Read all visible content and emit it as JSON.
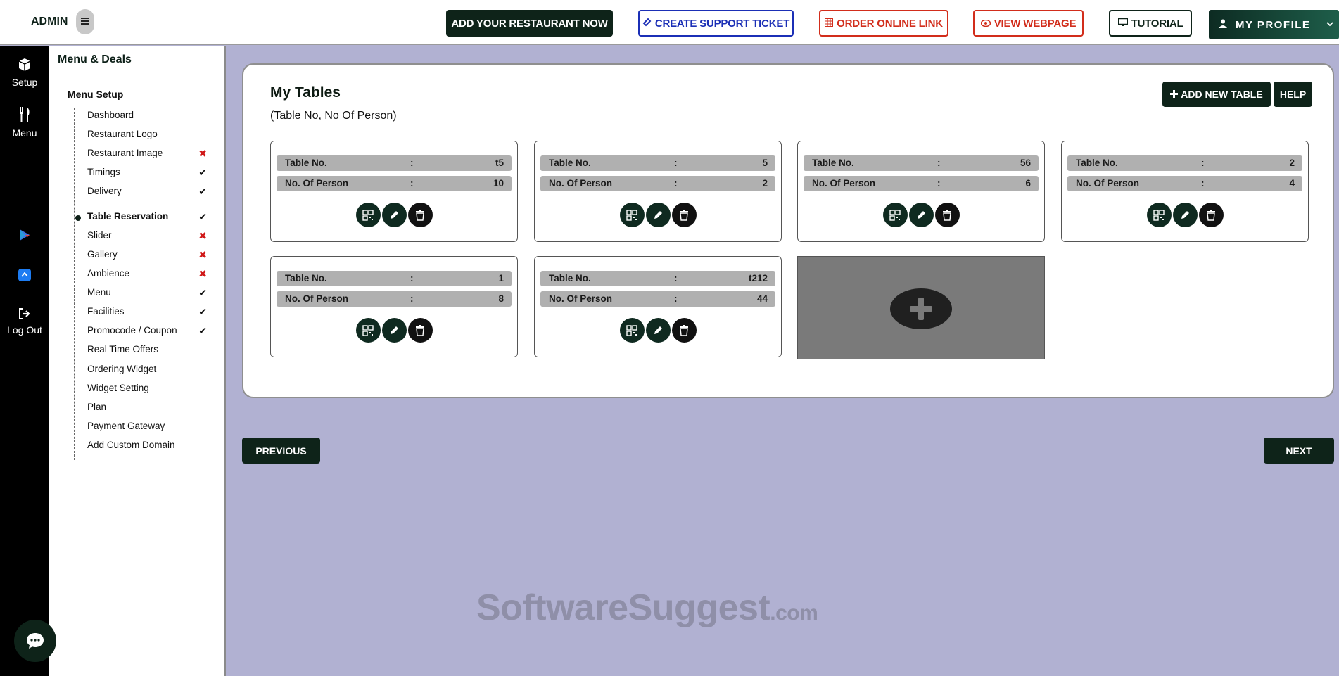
{
  "topbar": {
    "admin_label": "ADMIN",
    "add_restaurant": "ADD YOUR RESTAURANT NOW",
    "support_ticket": "CREATE SUPPORT TICKET",
    "order_online": "ORDER ONLINE LINK",
    "view_webpage": "VIEW WEBPAGE",
    "tutorial": "TUTORIAL",
    "profile": "MY PROFILE"
  },
  "rail": {
    "setup": "Setup",
    "menu": "Menu",
    "logout": "Log Out"
  },
  "sidebar": {
    "title": "Menu & Deals",
    "section": "Menu Setup",
    "items": [
      {
        "label": "Dashboard",
        "status": ""
      },
      {
        "label": "Restaurant Logo",
        "status": ""
      },
      {
        "label": "Restaurant Image",
        "status": "✖"
      },
      {
        "label": "Timings",
        "status": "✔"
      },
      {
        "label": "Delivery",
        "status": "✔"
      },
      {
        "label": "Table Reservation",
        "status": "✔"
      },
      {
        "label": "Slider",
        "status": "✖"
      },
      {
        "label": "Gallery",
        "status": "✖"
      },
      {
        "label": "Ambience",
        "status": "✖"
      },
      {
        "label": "Menu",
        "status": "✔"
      },
      {
        "label": "Facilities",
        "status": "✔"
      },
      {
        "label": "Promocode / Coupon",
        "status": "✔"
      },
      {
        "label": "Real Time Offers",
        "status": ""
      },
      {
        "label": "Ordering Widget",
        "status": ""
      },
      {
        "label": "Widget Setting",
        "status": ""
      },
      {
        "label": "Plan",
        "status": ""
      },
      {
        "label": "Payment Gateway",
        "status": ""
      },
      {
        "label": "Add Custom Domain",
        "status": ""
      }
    ]
  },
  "main": {
    "title": "My Tables",
    "subtitle": "(Table No, No Of Person)",
    "add_new_table": "ADD NEW TABLE",
    "help": "HELP",
    "table_label": "Table No.",
    "person_label": "No. Of Person",
    "colon": ":",
    "tables": [
      {
        "table_no": "t5",
        "persons": "10"
      },
      {
        "table_no": "5",
        "persons": "2"
      },
      {
        "table_no": "56",
        "persons": "6"
      },
      {
        "table_no": "2",
        "persons": "4"
      },
      {
        "table_no": "1",
        "persons": "8"
      },
      {
        "table_no": "t212",
        "persons": "44"
      }
    ],
    "previous": "PREVIOUS",
    "next": "NEXT"
  },
  "watermark": {
    "main": "SoftwareSuggest",
    "domain": ".com"
  },
  "colors": {
    "brand_dark": "#0e2319",
    "accent_blue": "#1b2fb6",
    "accent_red": "#d22d1b",
    "background": "#b1b1d2"
  }
}
